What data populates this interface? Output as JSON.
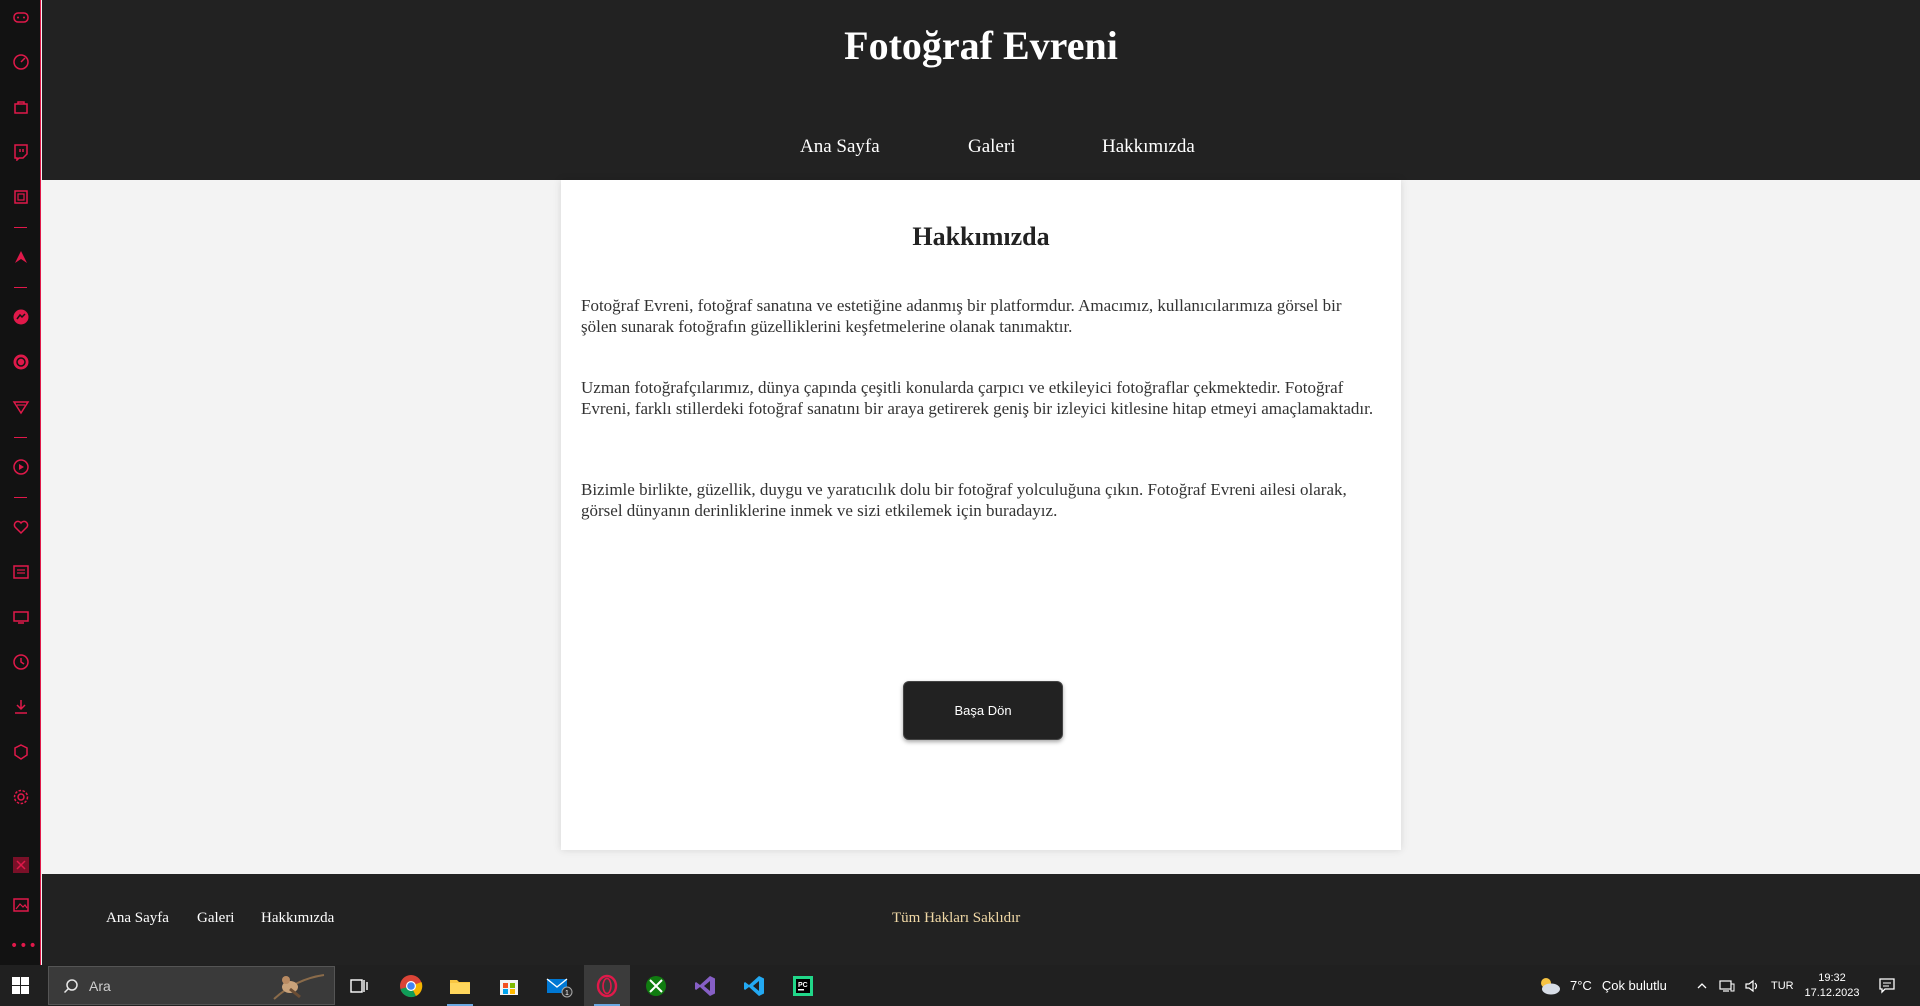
{
  "site": {
    "title": "Fotoğraf Evreni",
    "nav": [
      "Ana Sayfa",
      "Galeri",
      "Hakkımızda"
    ]
  },
  "about": {
    "heading": "Hakkımızda",
    "paragraphs": [
      "Fotoğraf Evreni, fotoğraf sanatına ve estetiğine adanmış bir platformdur. Amacımız, kullanıcılarımıza görsel bir şölen sunarak fotoğrafın güzelliklerini keşfetmelerine olanak tanımaktır.",
      "Uzman fotoğrafçılarımız, dünya çapında çeşitli konularda çarpıcı ve etkileyici fotoğraflar çekmektedir. Fotoğraf Evreni, farklı stillerdeki fotoğraf sanatını bir araya getirerek geniş bir izleyici kitlesine hitap etmeyi amaçlamaktadır.",
      "Bizimle birlikte, güzellik, duygu ve yaratıcılık dolu bir fotoğraf yolculuğuna çıkın. Fotoğraf Evreni ailesi olarak, görsel dünyanın derinliklerine inmek ve sizi etkilemek için buradayız."
    ],
    "back_button": "Başa Dön"
  },
  "footer": {
    "links": [
      "Ana Sayfa",
      "Galeri",
      "Hakkımızda"
    ],
    "copyright": "Tüm Hakları Saklıdır"
  },
  "taskbar": {
    "search_placeholder": "Ara",
    "weather_temp": "7°C",
    "weather_desc": "Çok bulutlu",
    "language": "TUR",
    "time": "19:32",
    "date": "17.12.2023",
    "mail_badge": "1",
    "apps": [
      "chrome-icon",
      "file-explorer-icon",
      "microsoft-store-icon",
      "mail-icon",
      "opera-gx-icon",
      "xbox-icon",
      "visual-studio-icon",
      "vscode-icon",
      "pycharm-icon"
    ]
  },
  "colors": {
    "header_bg": "#222222",
    "accent_sidebar": "#e0194a",
    "footer_copyright": "#f1d9a6",
    "page_bg": "#f3f3f3"
  }
}
